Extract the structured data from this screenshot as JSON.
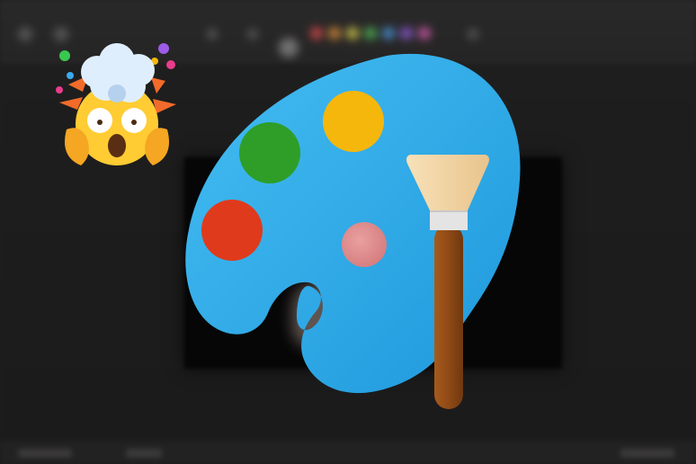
{
  "scene": {
    "background_color": "#1f1e1e",
    "logo": {
      "icon": "paint-palette-icon",
      "palette_color": "#2fa6e3",
      "paint_colors": [
        "#e03a1c",
        "#2e9e28",
        "#f5b70c",
        "#de8a8a"
      ],
      "brush_handle_color": "#8f4a16",
      "brush_ferrule_color": "#e4e4e4",
      "brush_bristle_color": "#f3d6a7"
    },
    "emoji": {
      "icon": "exploding-head-emoji-icon",
      "face_color": "#ffcc33",
      "cloud_color": "#dfeefc"
    }
  }
}
